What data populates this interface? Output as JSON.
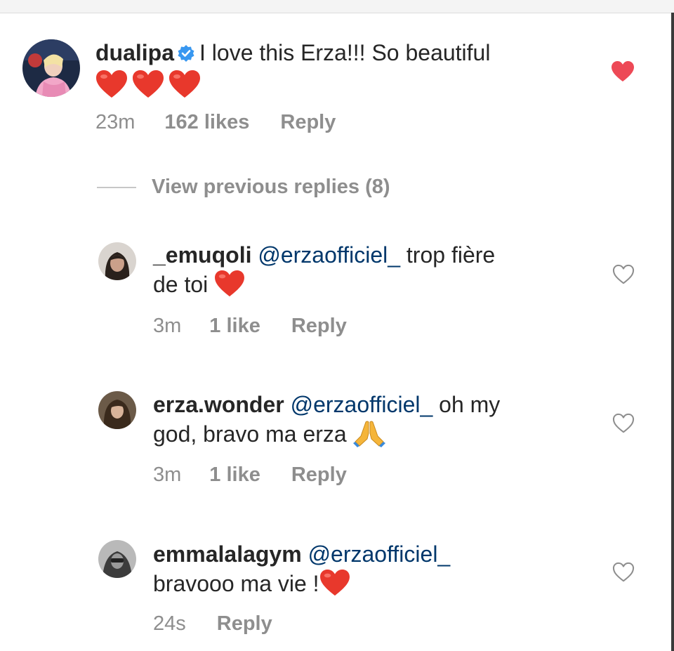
{
  "comment": {
    "username": "dualipa",
    "text": "I love this Erza!!! So beautiful",
    "emoji": "❤️❤️❤️",
    "time": "23m",
    "likes": "162 likes",
    "reply": "Reply",
    "liked": true
  },
  "view_previous": "View previous replies (8)",
  "replies": [
    {
      "username": "_emuqoli",
      "mention": "@erzaofficiel_",
      "text_1": "trop fière",
      "text_2": "de toi",
      "emoji": "❤️",
      "time": "3m",
      "likes": "1 like",
      "reply": "Reply"
    },
    {
      "username": "erza.wonder",
      "mention": "@erzaofficiel_",
      "text_1": "oh my",
      "text_2": "god, bravo ma erza",
      "emoji": "🙏",
      "time": "3m",
      "likes": "1 like",
      "reply": "Reply"
    },
    {
      "username": "emmalalagym",
      "mention": "@erzaofficiel_",
      "text_2": "bravooo ma vie !",
      "emoji": "❤️",
      "time": "24s",
      "reply": "Reply"
    }
  ],
  "colors": {
    "heart_liked": "#ed4956",
    "mention": "#00376b",
    "meta": "#8e8e8e",
    "verified": "#3897f0"
  },
  "icons": {
    "verified": "verified-badge-icon",
    "liked_heart": "heart-filled-icon",
    "heart": "heart-outline-icon",
    "red_heart_emoji": "red-heart-emoji-icon",
    "pray_emoji": "folded-hands-emoji-icon"
  }
}
